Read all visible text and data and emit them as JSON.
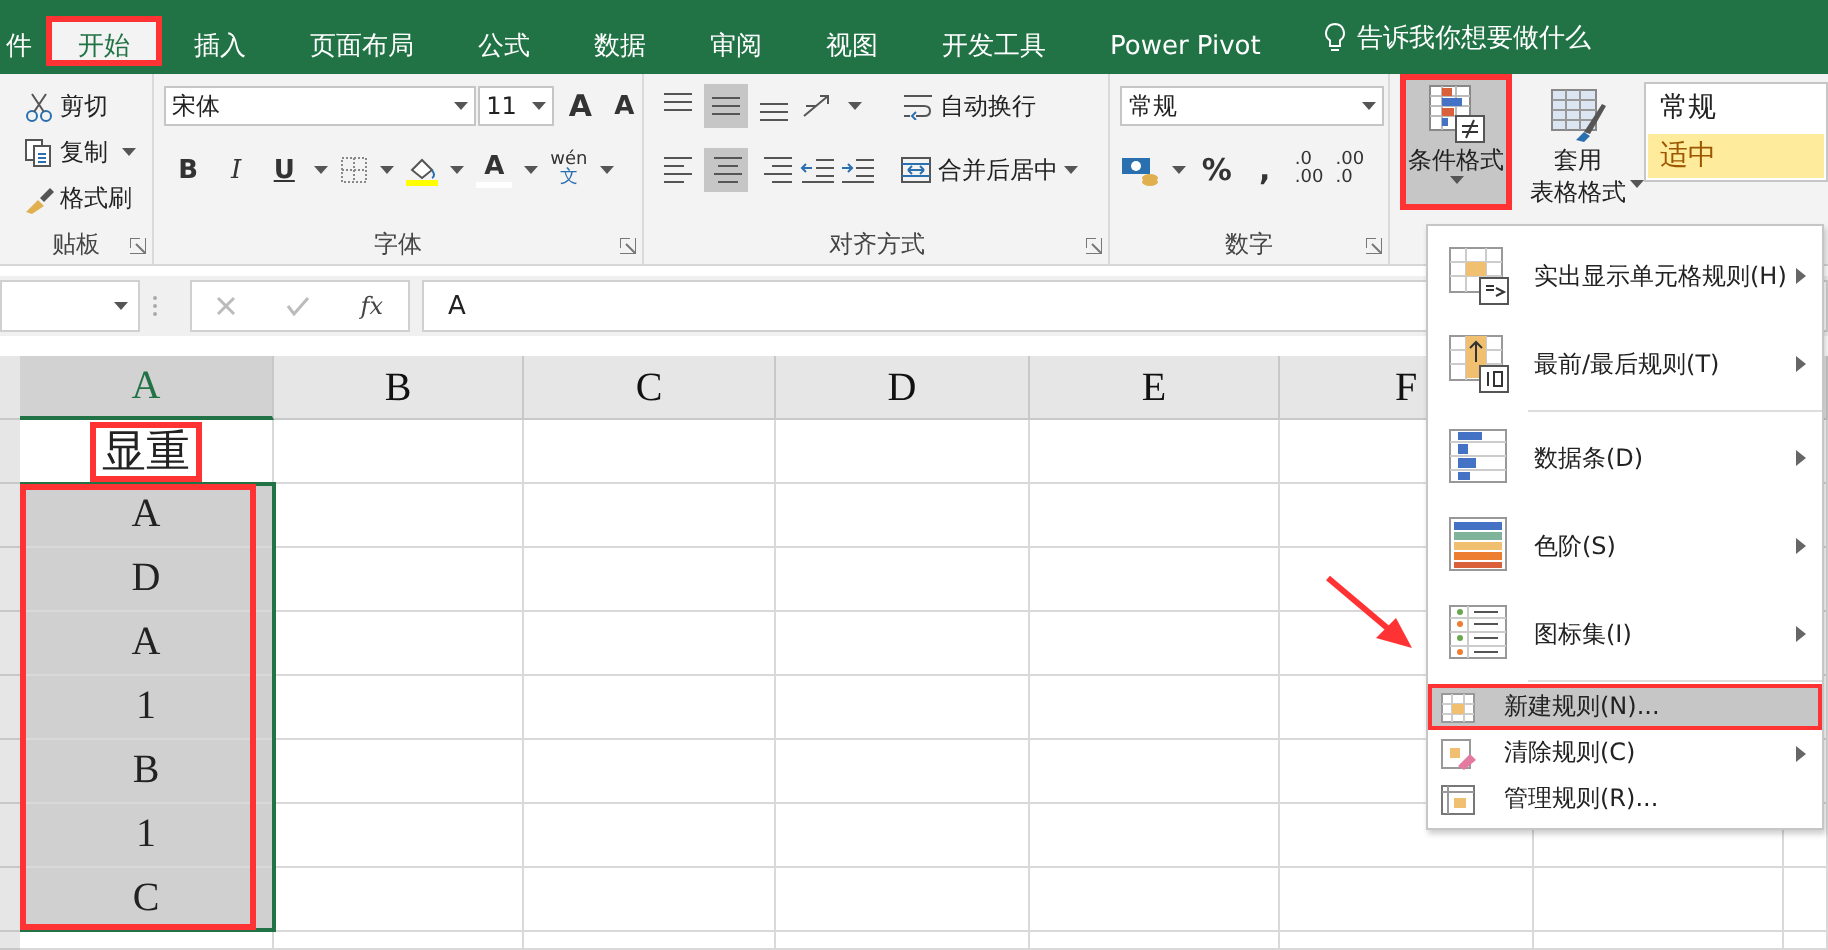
{
  "tabs": [
    {
      "label": "件",
      "selected": false,
      "marked": false
    },
    {
      "label": "开始",
      "selected": true,
      "marked": true
    },
    {
      "label": "插入",
      "selected": false,
      "marked": false
    },
    {
      "label": "页面布局",
      "selected": false,
      "marked": false
    },
    {
      "label": "公式",
      "selected": false,
      "marked": false
    },
    {
      "label": "数据",
      "selected": false,
      "marked": false
    },
    {
      "label": "审阅",
      "selected": false,
      "marked": false
    },
    {
      "label": "视图",
      "selected": false,
      "marked": false
    },
    {
      "label": "开发工具",
      "selected": false,
      "marked": false
    },
    {
      "label": "Power Pivot",
      "selected": false,
      "marked": false
    }
  ],
  "tell_me": "告诉我你想要做什么",
  "ribbon": {
    "clipboard": {
      "label": "贴板",
      "buttons": [
        {
          "label": "剪切",
          "kind": "cut",
          "dropdown": false
        },
        {
          "label": "复制",
          "kind": "copy",
          "dropdown": true
        },
        {
          "label": "格式刷",
          "kind": "brush",
          "dropdown": false
        }
      ]
    },
    "font": {
      "label": "字体",
      "name": "宋体",
      "size": "11",
      "grow": "A",
      "shrink": "A",
      "bold": "B",
      "italic": "I",
      "underline": "U",
      "font_color": "A",
      "phonetic": [
        "wén",
        "文"
      ]
    },
    "alignment": {
      "label": "对齐方式",
      "wrap": "自动换行",
      "merge": "合并后居中"
    },
    "number": {
      "label": "数字",
      "format": "常规",
      "percent": "%",
      "comma": ",",
      "increase_decimal": [
        ".0",
        ".00"
      ],
      "decrease_decimal": [
        ".00",
        ".0"
      ]
    },
    "styles": {
      "conditional": {
        "label": "条件格式",
        "pressed": true,
        "marked": true
      },
      "table_format": [
        "套用",
        "表格格式"
      ],
      "cell_styles": [
        {
          "label": "常规",
          "color": "#ffffff"
        },
        {
          "label": "适中",
          "color": "#ffeb9c"
        }
      ]
    }
  },
  "formula_bar": {
    "fx": "fx",
    "value": "A"
  },
  "sheet": {
    "columns": [
      {
        "label": "A",
        "selected": true
      },
      {
        "label": "B",
        "selected": false
      },
      {
        "label": "C",
        "selected": false
      },
      {
        "label": "D",
        "selected": false
      },
      {
        "label": "E",
        "selected": false
      },
      {
        "label": "F",
        "selected": false
      }
    ],
    "range_marked": true,
    "rows": [
      {
        "value": "显重",
        "selected": false,
        "marked": true
      },
      {
        "value": "A",
        "selected": true,
        "marked": false
      },
      {
        "value": "D",
        "selected": true,
        "marked": false
      },
      {
        "value": "A",
        "selected": true,
        "marked": false
      },
      {
        "value": "1",
        "selected": true,
        "marked": false
      },
      {
        "value": "B",
        "selected": true,
        "marked": false
      },
      {
        "value": "1",
        "selected": true,
        "marked": false
      },
      {
        "value": "C",
        "selected": true,
        "marked": false
      }
    ]
  },
  "menu": {
    "items": [
      {
        "label": "实出显示单元格规则(H)",
        "kind": "highlight",
        "submenu": true,
        "hovered": false,
        "marked": false
      },
      {
        "label": "最前/最后规则(T)",
        "kind": "top",
        "submenu": true,
        "hovered": false,
        "marked": false
      },
      {
        "label": "数据条(D)",
        "kind": "databar",
        "submenu": true,
        "hovered": false,
        "marked": false
      },
      {
        "label": "色阶(S)",
        "kind": "colorscale",
        "submenu": true,
        "hovered": false,
        "marked": false
      },
      {
        "label": "图标集(I)",
        "kind": "iconset",
        "submenu": true,
        "hovered": false,
        "marked": false
      },
      {
        "label": "新建规则(N)...",
        "kind": "new",
        "submenu": false,
        "hovered": true,
        "marked": true
      },
      {
        "label": "清除规则(C)",
        "kind": "clear",
        "submenu": true,
        "hovered": false,
        "marked": false
      },
      {
        "label": "管理规则(R)...",
        "kind": "manage",
        "submenu": false,
        "hovered": false,
        "marked": false
      }
    ]
  },
  "pointer_arrow": true
}
